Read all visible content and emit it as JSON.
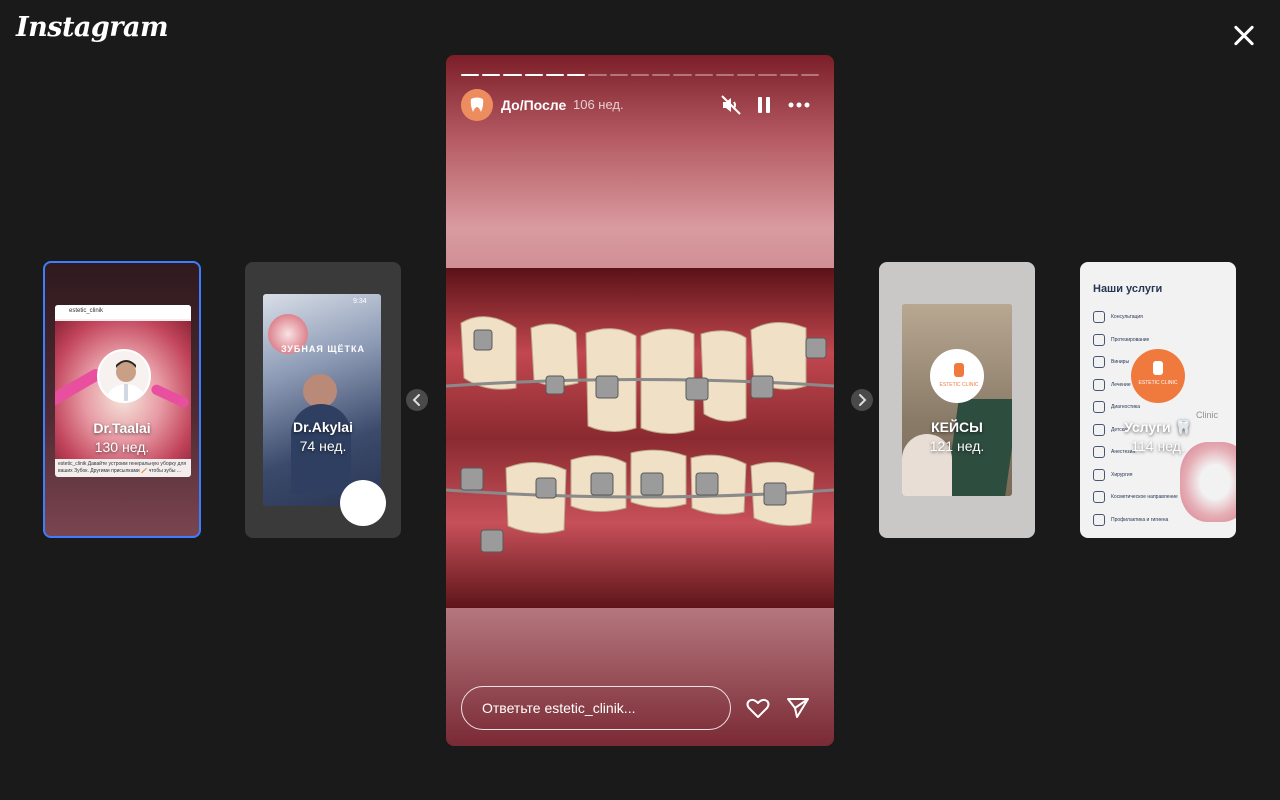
{
  "app": {
    "logo": "Instagram"
  },
  "cards": [
    {
      "name": "Dr.Taalai",
      "time": "130 нед.",
      "selected": true,
      "mini_header": "estetic_clinik",
      "mini_caption": "estetic_clinik Давайте устроим генеральную уборку для ваших Зубок. Другими присылками 🪥 чтобы зубы ..."
    },
    {
      "name": "Dr.Akylai",
      "time": "74 нед.",
      "mini_time": "9:34",
      "mini_text": "ЗУБНАЯ ЩЁТКА",
      "reaction": "😍"
    },
    {
      "name": "КЕЙСЫ",
      "time": "121 нед.",
      "logo_text": "ESTETIC CLINIC"
    },
    {
      "name": "Услуги 🦷",
      "time": "114 нед.",
      "logo_text": "ESTETIC CLINIC",
      "services_title": "Наши услуги",
      "services": [
        "Консультация",
        "Протезирование",
        "Виниры",
        "Лечение",
        "Диагностика",
        "Детская",
        "Анестезия",
        "Хирургия",
        "Косметическое направление",
        "Профилактика и гигиена"
      ],
      "clinic_label": "Clinic"
    }
  ],
  "story": {
    "title": "До/После",
    "time": "106 нед.",
    "segments_total": 17,
    "segments_done": 6,
    "reply_placeholder": "Ответьте estetic_clinik..."
  },
  "icons": {
    "close": "close-icon",
    "mute": "speaker-muted-icon",
    "pause": "pause-icon",
    "more": "more-horizontal-icon",
    "like": "heart-icon",
    "share": "send-icon",
    "prev": "chevron-left-icon",
    "next": "chevron-right-icon"
  },
  "colors": {
    "selected_border": "#3d7dff",
    "background": "#1a1a1a"
  }
}
